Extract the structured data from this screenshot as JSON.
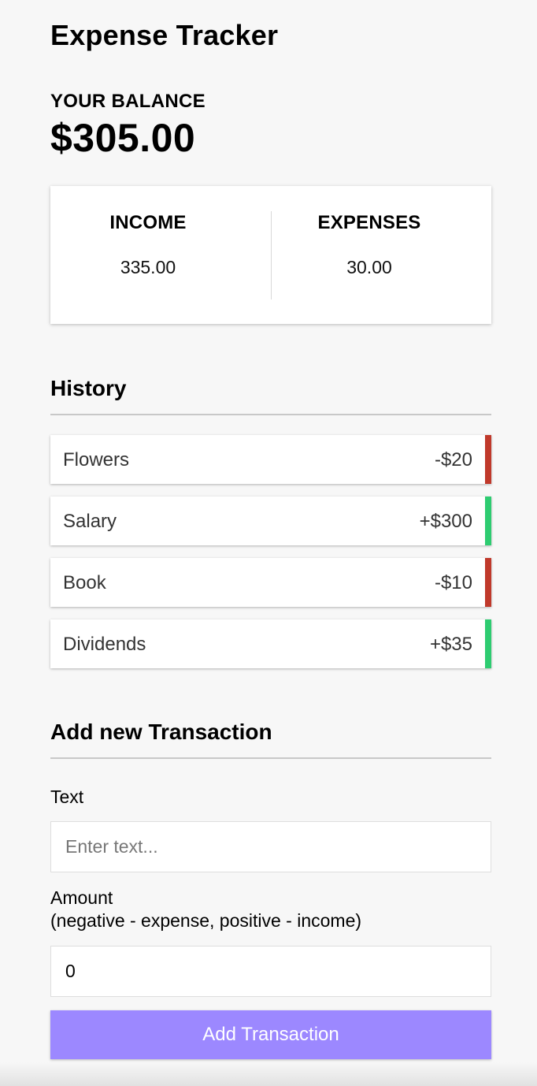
{
  "app": {
    "title": "Expense Tracker"
  },
  "balance": {
    "label": "YOUR BALANCE",
    "value": "$305.00"
  },
  "summary": {
    "income_label": "INCOME",
    "income_value": "335.00",
    "expense_label": "EXPENSES",
    "expense_value": "30.00"
  },
  "history": {
    "title": "History",
    "items": [
      {
        "text": "Flowers",
        "amount": "-$20",
        "type": "expense"
      },
      {
        "text": "Salary",
        "amount": "+$300",
        "type": "income"
      },
      {
        "text": "Book",
        "amount": "-$10",
        "type": "expense"
      },
      {
        "text": "Dividends",
        "amount": "+$35",
        "type": "income"
      }
    ]
  },
  "form": {
    "title": "Add new Transaction",
    "text_label": "Text",
    "text_placeholder": "Enter text...",
    "amount_label": "Amount",
    "amount_hint": "(negative - expense, positive - income)",
    "amount_value": "0",
    "submit_label": "Add Transaction"
  },
  "colors": {
    "income": "#2ecc71",
    "expense": "#c0392b",
    "button": "#9c88ff",
    "background": "#f7f7f7"
  }
}
